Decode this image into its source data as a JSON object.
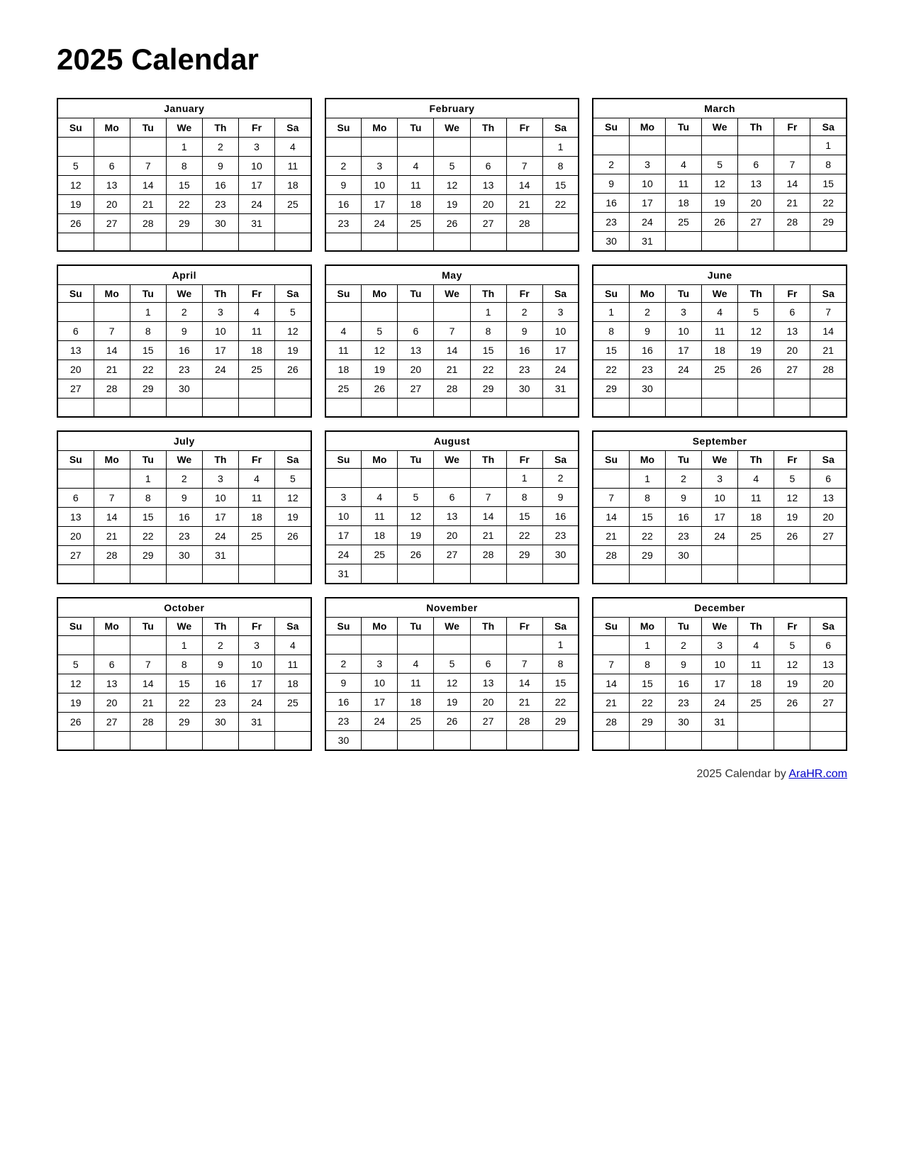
{
  "title": "2025 Calendar",
  "footer": {
    "text": "2025  Calendar by ",
    "link_label": "AraHR.com",
    "link_url": "AraHR.com"
  },
  "months": [
    {
      "name": "January",
      "days_header": [
        "Su",
        "Mo",
        "Tu",
        "We",
        "Th",
        "Fr",
        "Sa"
      ],
      "weeks": [
        [
          "",
          "",
          "",
          "1",
          "2",
          "3",
          "4"
        ],
        [
          "5",
          "6",
          "7",
          "8",
          "9",
          "10",
          "11"
        ],
        [
          "12",
          "13",
          "14",
          "15",
          "16",
          "17",
          "18"
        ],
        [
          "19",
          "20",
          "21",
          "22",
          "23",
          "24",
          "25"
        ],
        [
          "26",
          "27",
          "28",
          "29",
          "30",
          "31",
          ""
        ],
        [
          "",
          "",
          "",
          "",
          "",
          "",
          ""
        ]
      ]
    },
    {
      "name": "February",
      "days_header": [
        "Su",
        "Mo",
        "Tu",
        "We",
        "Th",
        "Fr",
        "Sa"
      ],
      "weeks": [
        [
          "",
          "",
          "",
          "",
          "",
          "",
          "1"
        ],
        [
          "2",
          "3",
          "4",
          "5",
          "6",
          "7",
          "8"
        ],
        [
          "9",
          "10",
          "11",
          "12",
          "13",
          "14",
          "15"
        ],
        [
          "16",
          "17",
          "18",
          "19",
          "20",
          "21",
          "22"
        ],
        [
          "23",
          "24",
          "25",
          "26",
          "27",
          "28",
          ""
        ],
        [
          "",
          "",
          "",
          "",
          "",
          "",
          ""
        ]
      ]
    },
    {
      "name": "March",
      "days_header": [
        "Su",
        "Mo",
        "Tu",
        "We",
        "Th",
        "Fr",
        "Sa"
      ],
      "weeks": [
        [
          "",
          "",
          "",
          "",
          "",
          "",
          "1"
        ],
        [
          "2",
          "3",
          "4",
          "5",
          "6",
          "7",
          "8"
        ],
        [
          "9",
          "10",
          "11",
          "12",
          "13",
          "14",
          "15"
        ],
        [
          "16",
          "17",
          "18",
          "19",
          "20",
          "21",
          "22"
        ],
        [
          "23",
          "24",
          "25",
          "26",
          "27",
          "28",
          "29"
        ],
        [
          "30",
          "31",
          "",
          "",
          "",
          "",
          ""
        ]
      ]
    },
    {
      "name": "April",
      "days_header": [
        "Su",
        "Mo",
        "Tu",
        "We",
        "Th",
        "Fr",
        "Sa"
      ],
      "weeks": [
        [
          "",
          "",
          "1",
          "2",
          "3",
          "4",
          "5"
        ],
        [
          "6",
          "7",
          "8",
          "9",
          "10",
          "11",
          "12"
        ],
        [
          "13",
          "14",
          "15",
          "16",
          "17",
          "18",
          "19"
        ],
        [
          "20",
          "21",
          "22",
          "23",
          "24",
          "25",
          "26"
        ],
        [
          "27",
          "28",
          "29",
          "30",
          "",
          "",
          ""
        ],
        [
          "",
          "",
          "",
          "",
          "",
          "",
          ""
        ]
      ]
    },
    {
      "name": "May",
      "days_header": [
        "Su",
        "Mo",
        "Tu",
        "We",
        "Th",
        "Fr",
        "Sa"
      ],
      "weeks": [
        [
          "",
          "",
          "",
          "",
          "1",
          "2",
          "3"
        ],
        [
          "4",
          "5",
          "6",
          "7",
          "8",
          "9",
          "10"
        ],
        [
          "11",
          "12",
          "13",
          "14",
          "15",
          "16",
          "17"
        ],
        [
          "18",
          "19",
          "20",
          "21",
          "22",
          "23",
          "24"
        ],
        [
          "25",
          "26",
          "27",
          "28",
          "29",
          "30",
          "31"
        ],
        [
          "",
          "",
          "",
          "",
          "",
          "",
          ""
        ]
      ]
    },
    {
      "name": "June",
      "days_header": [
        "Su",
        "Mo",
        "Tu",
        "We",
        "Th",
        "Fr",
        "Sa"
      ],
      "weeks": [
        [
          "1",
          "2",
          "3",
          "4",
          "5",
          "6",
          "7"
        ],
        [
          "8",
          "9",
          "10",
          "11",
          "12",
          "13",
          "14"
        ],
        [
          "15",
          "16",
          "17",
          "18",
          "19",
          "20",
          "21"
        ],
        [
          "22",
          "23",
          "24",
          "25",
          "26",
          "27",
          "28"
        ],
        [
          "29",
          "30",
          "",
          "",
          "",
          "",
          ""
        ],
        [
          "",
          "",
          "",
          "",
          "",
          "",
          ""
        ]
      ]
    },
    {
      "name": "July",
      "days_header": [
        "Su",
        "Mo",
        "Tu",
        "We",
        "Th",
        "Fr",
        "Sa"
      ],
      "weeks": [
        [
          "",
          "",
          "1",
          "2",
          "3",
          "4",
          "5"
        ],
        [
          "6",
          "7",
          "8",
          "9",
          "10",
          "11",
          "12"
        ],
        [
          "13",
          "14",
          "15",
          "16",
          "17",
          "18",
          "19"
        ],
        [
          "20",
          "21",
          "22",
          "23",
          "24",
          "25",
          "26"
        ],
        [
          "27",
          "28",
          "29",
          "30",
          "31",
          "",
          ""
        ],
        [
          "",
          "",
          "",
          "",
          "",
          "",
          ""
        ]
      ]
    },
    {
      "name": "August",
      "days_header": [
        "Su",
        "Mo",
        "Tu",
        "We",
        "Th",
        "Fr",
        "Sa"
      ],
      "weeks": [
        [
          "",
          "",
          "",
          "",
          "",
          "1",
          "2"
        ],
        [
          "3",
          "4",
          "5",
          "6",
          "7",
          "8",
          "9"
        ],
        [
          "10",
          "11",
          "12",
          "13",
          "14",
          "15",
          "16"
        ],
        [
          "17",
          "18",
          "19",
          "20",
          "21",
          "22",
          "23"
        ],
        [
          "24",
          "25",
          "26",
          "27",
          "28",
          "29",
          "30"
        ],
        [
          "31",
          "",
          "",
          "",
          "",
          "",
          ""
        ]
      ]
    },
    {
      "name": "September",
      "days_header": [
        "Su",
        "Mo",
        "Tu",
        "We",
        "Th",
        "Fr",
        "Sa"
      ],
      "weeks": [
        [
          "",
          "1",
          "2",
          "3",
          "4",
          "5",
          "6"
        ],
        [
          "7",
          "8",
          "9",
          "10",
          "11",
          "12",
          "13"
        ],
        [
          "14",
          "15",
          "16",
          "17",
          "18",
          "19",
          "20"
        ],
        [
          "21",
          "22",
          "23",
          "24",
          "25",
          "26",
          "27"
        ],
        [
          "28",
          "29",
          "30",
          "",
          "",
          "",
          ""
        ],
        [
          "",
          "",
          "",
          "",
          "",
          "",
          ""
        ]
      ]
    },
    {
      "name": "October",
      "days_header": [
        "Su",
        "Mo",
        "Tu",
        "We",
        "Th",
        "Fr",
        "Sa"
      ],
      "weeks": [
        [
          "",
          "",
          "",
          "1",
          "2",
          "3",
          "4"
        ],
        [
          "5",
          "6",
          "7",
          "8",
          "9",
          "10",
          "11"
        ],
        [
          "12",
          "13",
          "14",
          "15",
          "16",
          "17",
          "18"
        ],
        [
          "19",
          "20",
          "21",
          "22",
          "23",
          "24",
          "25"
        ],
        [
          "26",
          "27",
          "28",
          "29",
          "30",
          "31",
          ""
        ],
        [
          "",
          "",
          "",
          "",
          "",
          "",
          ""
        ]
      ]
    },
    {
      "name": "November",
      "days_header": [
        "Su",
        "Mo",
        "Tu",
        "We",
        "Th",
        "Fr",
        "Sa"
      ],
      "weeks": [
        [
          "",
          "",
          "",
          "",
          "",
          "",
          "1"
        ],
        [
          "2",
          "3",
          "4",
          "5",
          "6",
          "7",
          "8"
        ],
        [
          "9",
          "10",
          "11",
          "12",
          "13",
          "14",
          "15"
        ],
        [
          "16",
          "17",
          "18",
          "19",
          "20",
          "21",
          "22"
        ],
        [
          "23",
          "24",
          "25",
          "26",
          "27",
          "28",
          "29"
        ],
        [
          "30",
          "",
          "",
          "",
          "",
          "",
          ""
        ]
      ]
    },
    {
      "name": "December",
      "days_header": [
        "Su",
        "Mo",
        "Tu",
        "We",
        "Th",
        "Fr",
        "Sa"
      ],
      "weeks": [
        [
          "",
          "1",
          "2",
          "3",
          "4",
          "5",
          "6"
        ],
        [
          "7",
          "8",
          "9",
          "10",
          "11",
          "12",
          "13"
        ],
        [
          "14",
          "15",
          "16",
          "17",
          "18",
          "19",
          "20"
        ],
        [
          "21",
          "22",
          "23",
          "24",
          "25",
          "26",
          "27"
        ],
        [
          "28",
          "29",
          "30",
          "31",
          "",
          "",
          ""
        ],
        [
          "",
          "",
          "",
          "",
          "",
          "",
          ""
        ]
      ]
    }
  ]
}
